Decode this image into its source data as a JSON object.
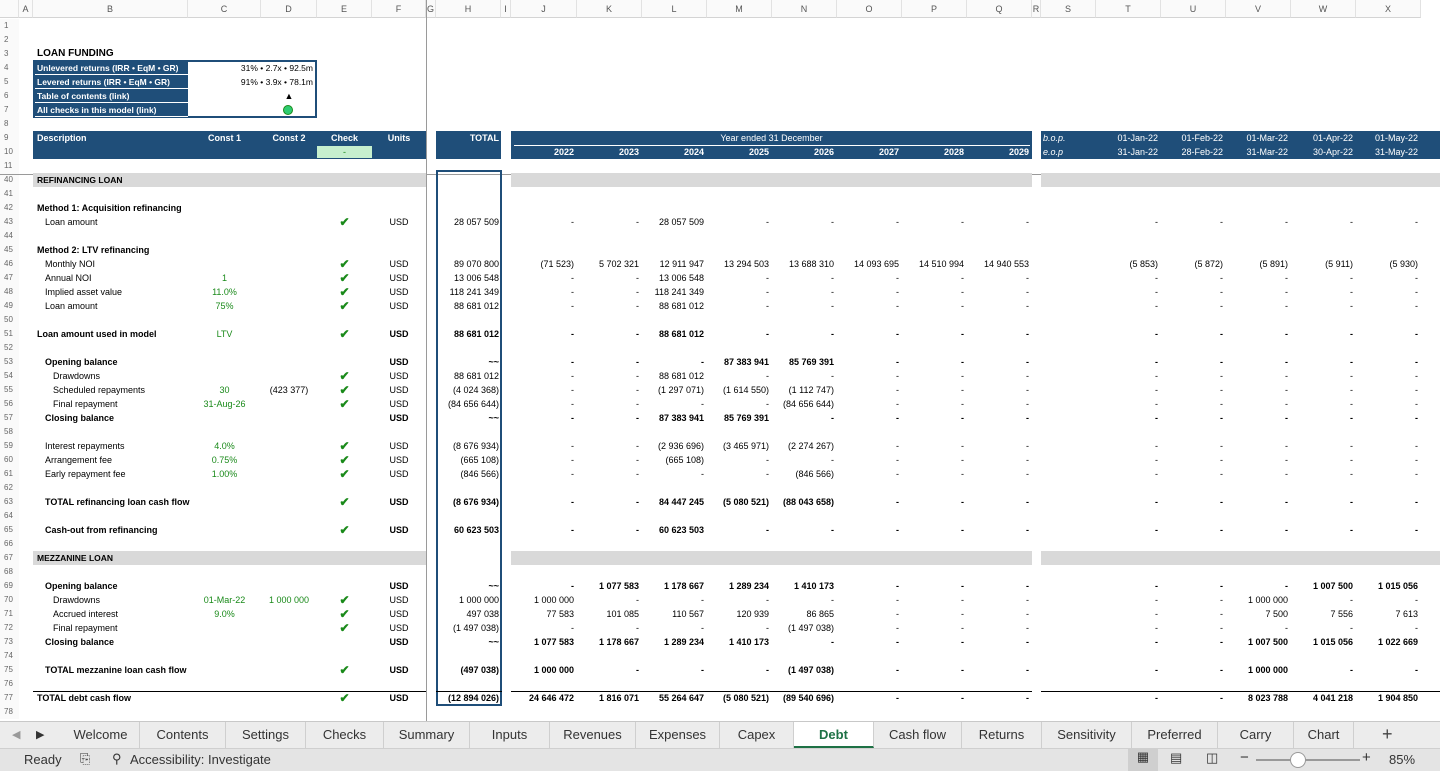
{
  "columns": [
    "A",
    "B",
    "C",
    "D",
    "E",
    "F",
    "G",
    "H",
    "I",
    "J",
    "K",
    "L",
    "M",
    "N",
    "O",
    "P",
    "Q",
    "R",
    "S",
    "T",
    "U",
    "V",
    "W",
    "X"
  ],
  "title": "LOAN FUNDING",
  "summary": {
    "rows": [
      {
        "label": "Unlevered returns (IRR • EqM • GR)",
        "value": "31% • 2.7x • 92.5m"
      },
      {
        "label": "Levered returns (IRR • EqM • GR)",
        "value": "91% • 3.9x • 78.1m"
      },
      {
        "label": "Table of contents (link)",
        "value": "▲"
      },
      {
        "label": "All checks in this model (link)",
        "value": ""
      }
    ]
  },
  "header": {
    "description": "Description",
    "const1": "Const 1",
    "const2": "Const 2",
    "check": "Check",
    "check_value": "-",
    "units": "Units",
    "total": "TOTAL",
    "year_ended": "Year ended 31 December",
    "years": [
      "2022",
      "2023",
      "2024",
      "2025",
      "2026",
      "2027",
      "2028",
      "2029"
    ],
    "bop": "b.o.p.",
    "eop": "e.o.p",
    "month_starts": [
      "01-Jan-22",
      "01-Feb-22",
      "01-Mar-22",
      "01-Apr-22",
      "01-May-22"
    ],
    "month_ends": [
      "31-Jan-22",
      "28-Feb-22",
      "31-Mar-22",
      "30-Apr-22",
      "31-May-22"
    ]
  },
  "rows": [
    {
      "n": "1"
    },
    {
      "n": "2"
    },
    {
      "n": "3"
    },
    {
      "n": "4"
    },
    {
      "n": "5"
    },
    {
      "n": "6"
    },
    {
      "n": "7"
    },
    {
      "n": "8"
    },
    {
      "n": "9"
    },
    {
      "n": "10"
    },
    {
      "n": "11"
    },
    {
      "n": "40",
      "section": true,
      "label": "REFINANCING LOAN"
    },
    {
      "n": "41"
    },
    {
      "n": "42",
      "label": "Method 1: Acquisition refinancing",
      "bold": true
    },
    {
      "n": "43",
      "label": "Loan amount",
      "indent": 1,
      "check": true,
      "units": "USD",
      "total": "28 057 509",
      "years": [
        "-",
        "-",
        "28 057 509",
        "-",
        "-",
        "-",
        "-",
        "-"
      ],
      "months": [
        "-",
        "-",
        "-",
        "-",
        "-"
      ]
    },
    {
      "n": "44"
    },
    {
      "n": "45",
      "label": "Method 2: LTV refinancing",
      "bold": true
    },
    {
      "n": "46",
      "label": "Monthly NOI",
      "indent": 1,
      "check": true,
      "units": "USD",
      "total": "89 070 800",
      "years": [
        "(71 523)",
        "5 702 321",
        "12 911 947",
        "13 294 503",
        "13 688 310",
        "14 093 695",
        "14 510 994",
        "14 940 553"
      ],
      "months": [
        "(5 853)",
        "(5 872)",
        "(5 891)",
        "(5 911)",
        "(5 930)"
      ]
    },
    {
      "n": "47",
      "label": "Annual NOI",
      "indent": 1,
      "c1": "1",
      "check": true,
      "units": "USD",
      "total": "13 006 548",
      "years": [
        "-",
        "-",
        "13 006 548",
        "-",
        "-",
        "-",
        "-",
        "-"
      ],
      "months": [
        "-",
        "-",
        "-",
        "-",
        "-"
      ]
    },
    {
      "n": "48",
      "label": "Implied asset value",
      "indent": 1,
      "c1": "11.0%",
      "check": true,
      "units": "USD",
      "total": "118 241 349",
      "years": [
        "-",
        "-",
        "118 241 349",
        "-",
        "-",
        "-",
        "-",
        "-"
      ],
      "months": [
        "-",
        "-",
        "-",
        "-",
        "-"
      ]
    },
    {
      "n": "49",
      "label": "Loan amount",
      "indent": 1,
      "c1": "75%",
      "check": true,
      "units": "USD",
      "total": "88 681 012",
      "years": [
        "-",
        "-",
        "88 681 012",
        "-",
        "-",
        "-",
        "-",
        "-"
      ],
      "months": [
        "-",
        "-",
        "-",
        "-",
        "-"
      ]
    },
    {
      "n": "50"
    },
    {
      "n": "51",
      "label": "Loan amount used in model",
      "bold": true,
      "c1": "LTV",
      "check": true,
      "units": "USD",
      "total": "88 681 012",
      "years": [
        "-",
        "-",
        "88 681 012",
        "-",
        "-",
        "-",
        "-",
        "-"
      ],
      "months": [
        "-",
        "-",
        "-",
        "-",
        "-"
      ]
    },
    {
      "n": "52"
    },
    {
      "n": "53",
      "label": "Opening balance",
      "indent": 1,
      "bold": true,
      "units": "USD",
      "total": "~~",
      "years": [
        "-",
        "-",
        "-",
        "87 383 941",
        "85 769 391",
        "-",
        "-",
        "-"
      ],
      "months": [
        "-",
        "-",
        "-",
        "-",
        "-"
      ]
    },
    {
      "n": "54",
      "label": "Drawdowns",
      "indent": 2,
      "check": true,
      "units": "USD",
      "total": "88 681 012",
      "years": [
        "-",
        "-",
        "88 681 012",
        "-",
        "-",
        "-",
        "-",
        "-"
      ],
      "months": [
        "-",
        "-",
        "-",
        "-",
        "-"
      ]
    },
    {
      "n": "55",
      "label": "Scheduled repayments",
      "indent": 2,
      "c1": "30",
      "c2": "(423 377)",
      "check": true,
      "units": "USD",
      "total": "(4 024 368)",
      "years": [
        "-",
        "-",
        "(1 297 071)",
        "(1 614 550)",
        "(1 112 747)",
        "-",
        "-",
        "-"
      ],
      "months": [
        "-",
        "-",
        "-",
        "-",
        "-"
      ]
    },
    {
      "n": "56",
      "label": "Final repayment",
      "indent": 2,
      "c1": "31-Aug-26",
      "check": true,
      "units": "USD",
      "total": "(84 656 644)",
      "years": [
        "-",
        "-",
        "-",
        "-",
        "(84 656 644)",
        "-",
        "-",
        "-"
      ],
      "months": [
        "-",
        "-",
        "-",
        "-",
        "-"
      ]
    },
    {
      "n": "57",
      "label": "Closing balance",
      "indent": 1,
      "bold": true,
      "units": "USD",
      "total": "~~",
      "years": [
        "-",
        "-",
        "87 383 941",
        "85 769 391",
        "-",
        "-",
        "-",
        "-"
      ],
      "months": [
        "-",
        "-",
        "-",
        "-",
        "-"
      ]
    },
    {
      "n": "58"
    },
    {
      "n": "59",
      "label": "Interest repayments",
      "indent": 1,
      "c1": "4.0%",
      "check": true,
      "units": "USD",
      "total": "(8 676 934)",
      "years": [
        "-",
        "-",
        "(2 936 696)",
        "(3 465 971)",
        "(2 274 267)",
        "-",
        "-",
        "-"
      ],
      "months": [
        "-",
        "-",
        "-",
        "-",
        "-"
      ]
    },
    {
      "n": "60",
      "label": "Arrangement fee",
      "indent": 1,
      "c1": "0.75%",
      "check": true,
      "units": "USD",
      "total": "(665 108)",
      "years": [
        "-",
        "-",
        "(665 108)",
        "-",
        "-",
        "-",
        "-",
        "-"
      ],
      "months": [
        "-",
        "-",
        "-",
        "-",
        "-"
      ]
    },
    {
      "n": "61",
      "label": "Early repayment fee",
      "indent": 1,
      "c1": "1.00%",
      "check": true,
      "units": "USD",
      "total": "(846 566)",
      "years": [
        "-",
        "-",
        "-",
        "-",
        "(846 566)",
        "-",
        "-",
        "-"
      ],
      "months": [
        "-",
        "-",
        "-",
        "-",
        "-"
      ]
    },
    {
      "n": "62"
    },
    {
      "n": "63",
      "label": "TOTAL refinancing loan cash flow",
      "indent": 1,
      "bold": true,
      "check": true,
      "units": "USD",
      "total": "(8 676 934)",
      "years": [
        "-",
        "-",
        "84 447 245",
        "(5 080 521)",
        "(88 043 658)",
        "-",
        "-",
        "-"
      ],
      "months": [
        "-",
        "-",
        "-",
        "-",
        "-"
      ]
    },
    {
      "n": "64"
    },
    {
      "n": "65",
      "label": "Cash-out from refinancing",
      "indent": 1,
      "bold": true,
      "check": true,
      "units": "USD",
      "total": "60 623 503",
      "years": [
        "-",
        "-",
        "60 623 503",
        "-",
        "-",
        "-",
        "-",
        "-"
      ],
      "months": [
        "-",
        "-",
        "-",
        "-",
        "-"
      ]
    },
    {
      "n": "66"
    },
    {
      "n": "67",
      "section": true,
      "label": "MEZZANINE LOAN"
    },
    {
      "n": "68"
    },
    {
      "n": "69",
      "label": "Opening balance",
      "indent": 1,
      "bold": true,
      "units": "USD",
      "total": "~~",
      "years": [
        "-",
        "1 077 583",
        "1 178 667",
        "1 289 234",
        "1 410 173",
        "-",
        "-",
        "-"
      ],
      "months": [
        "-",
        "-",
        "-",
        "1 007 500",
        "1 015 056"
      ]
    },
    {
      "n": "70",
      "label": "Drawdowns",
      "indent": 2,
      "c1": "01-Mar-22",
      "c2": "1 000 000",
      "check": true,
      "units": "USD",
      "total": "1 000 000",
      "years": [
        "1 000 000",
        "-",
        "-",
        "-",
        "-",
        "-",
        "-",
        "-"
      ],
      "months": [
        "-",
        "-",
        "1 000 000",
        "-",
        "-"
      ]
    },
    {
      "n": "71",
      "label": "Accrued interest",
      "indent": 2,
      "c1": "9.0%",
      "check": true,
      "units": "USD",
      "total": "497 038",
      "years": [
        "77 583",
        "101 085",
        "110 567",
        "120 939",
        "86 865",
        "-",
        "-",
        "-"
      ],
      "months": [
        "-",
        "-",
        "7 500",
        "7 556",
        "7 613"
      ]
    },
    {
      "n": "72",
      "label": "Final repayment",
      "indent": 2,
      "check": true,
      "units": "USD",
      "total": "(1 497 038)",
      "years": [
        "-",
        "-",
        "-",
        "-",
        "(1 497 038)",
        "-",
        "-",
        "-"
      ],
      "months": [
        "-",
        "-",
        "-",
        "-",
        "-"
      ]
    },
    {
      "n": "73",
      "label": "Closing balance",
      "indent": 1,
      "bold": true,
      "units": "USD",
      "total": "~~",
      "years": [
        "1 077 583",
        "1 178 667",
        "1 289 234",
        "1 410 173",
        "-",
        "-",
        "-",
        "-"
      ],
      "months": [
        "-",
        "-",
        "1 007 500",
        "1 015 056",
        "1 022 669"
      ]
    },
    {
      "n": "74"
    },
    {
      "n": "75",
      "label": "TOTAL mezzanine loan cash flow",
      "indent": 1,
      "bold": true,
      "check": true,
      "units": "USD",
      "total": "(497 038)",
      "years": [
        "1 000 000",
        "-",
        "-",
        "-",
        "(1 497 038)",
        "-",
        "-",
        "-"
      ],
      "months": [
        "-",
        "-",
        "1 000 000",
        "-",
        "-"
      ]
    },
    {
      "n": "76"
    },
    {
      "n": "77",
      "label": "TOTAL debt cash flow",
      "bold": true,
      "check": true,
      "units": "USD",
      "total": "(12 894 026)",
      "years": [
        "24 646 472",
        "1 816 071",
        "55 264 647",
        "(5 080 521)",
        "(89 540 696)",
        "-",
        "-",
        "-"
      ],
      "months": [
        "-",
        "-",
        "8 023 788",
        "4 041 218",
        "1 904 850"
      ],
      "topline": true
    },
    {
      "n": "78"
    }
  ],
  "tabs": [
    "Welcome",
    "Contents",
    "Settings",
    "Checks",
    "Summary",
    "Inputs",
    "Revenues",
    "Expenses",
    "Capex",
    "Debt",
    "Cash flow",
    "Returns",
    "Sensitivity",
    "Preferred",
    "Carry",
    "Chart"
  ],
  "active_tab": "Debt",
  "status": {
    "ready": "Ready",
    "accessibility": "Accessibility: Investigate",
    "zoom": "85%"
  },
  "colors": {
    "navy": "#1f4e79",
    "green": "#1a8a1a",
    "grey": "#d9d9d9",
    "accent": "#1e7145"
  }
}
